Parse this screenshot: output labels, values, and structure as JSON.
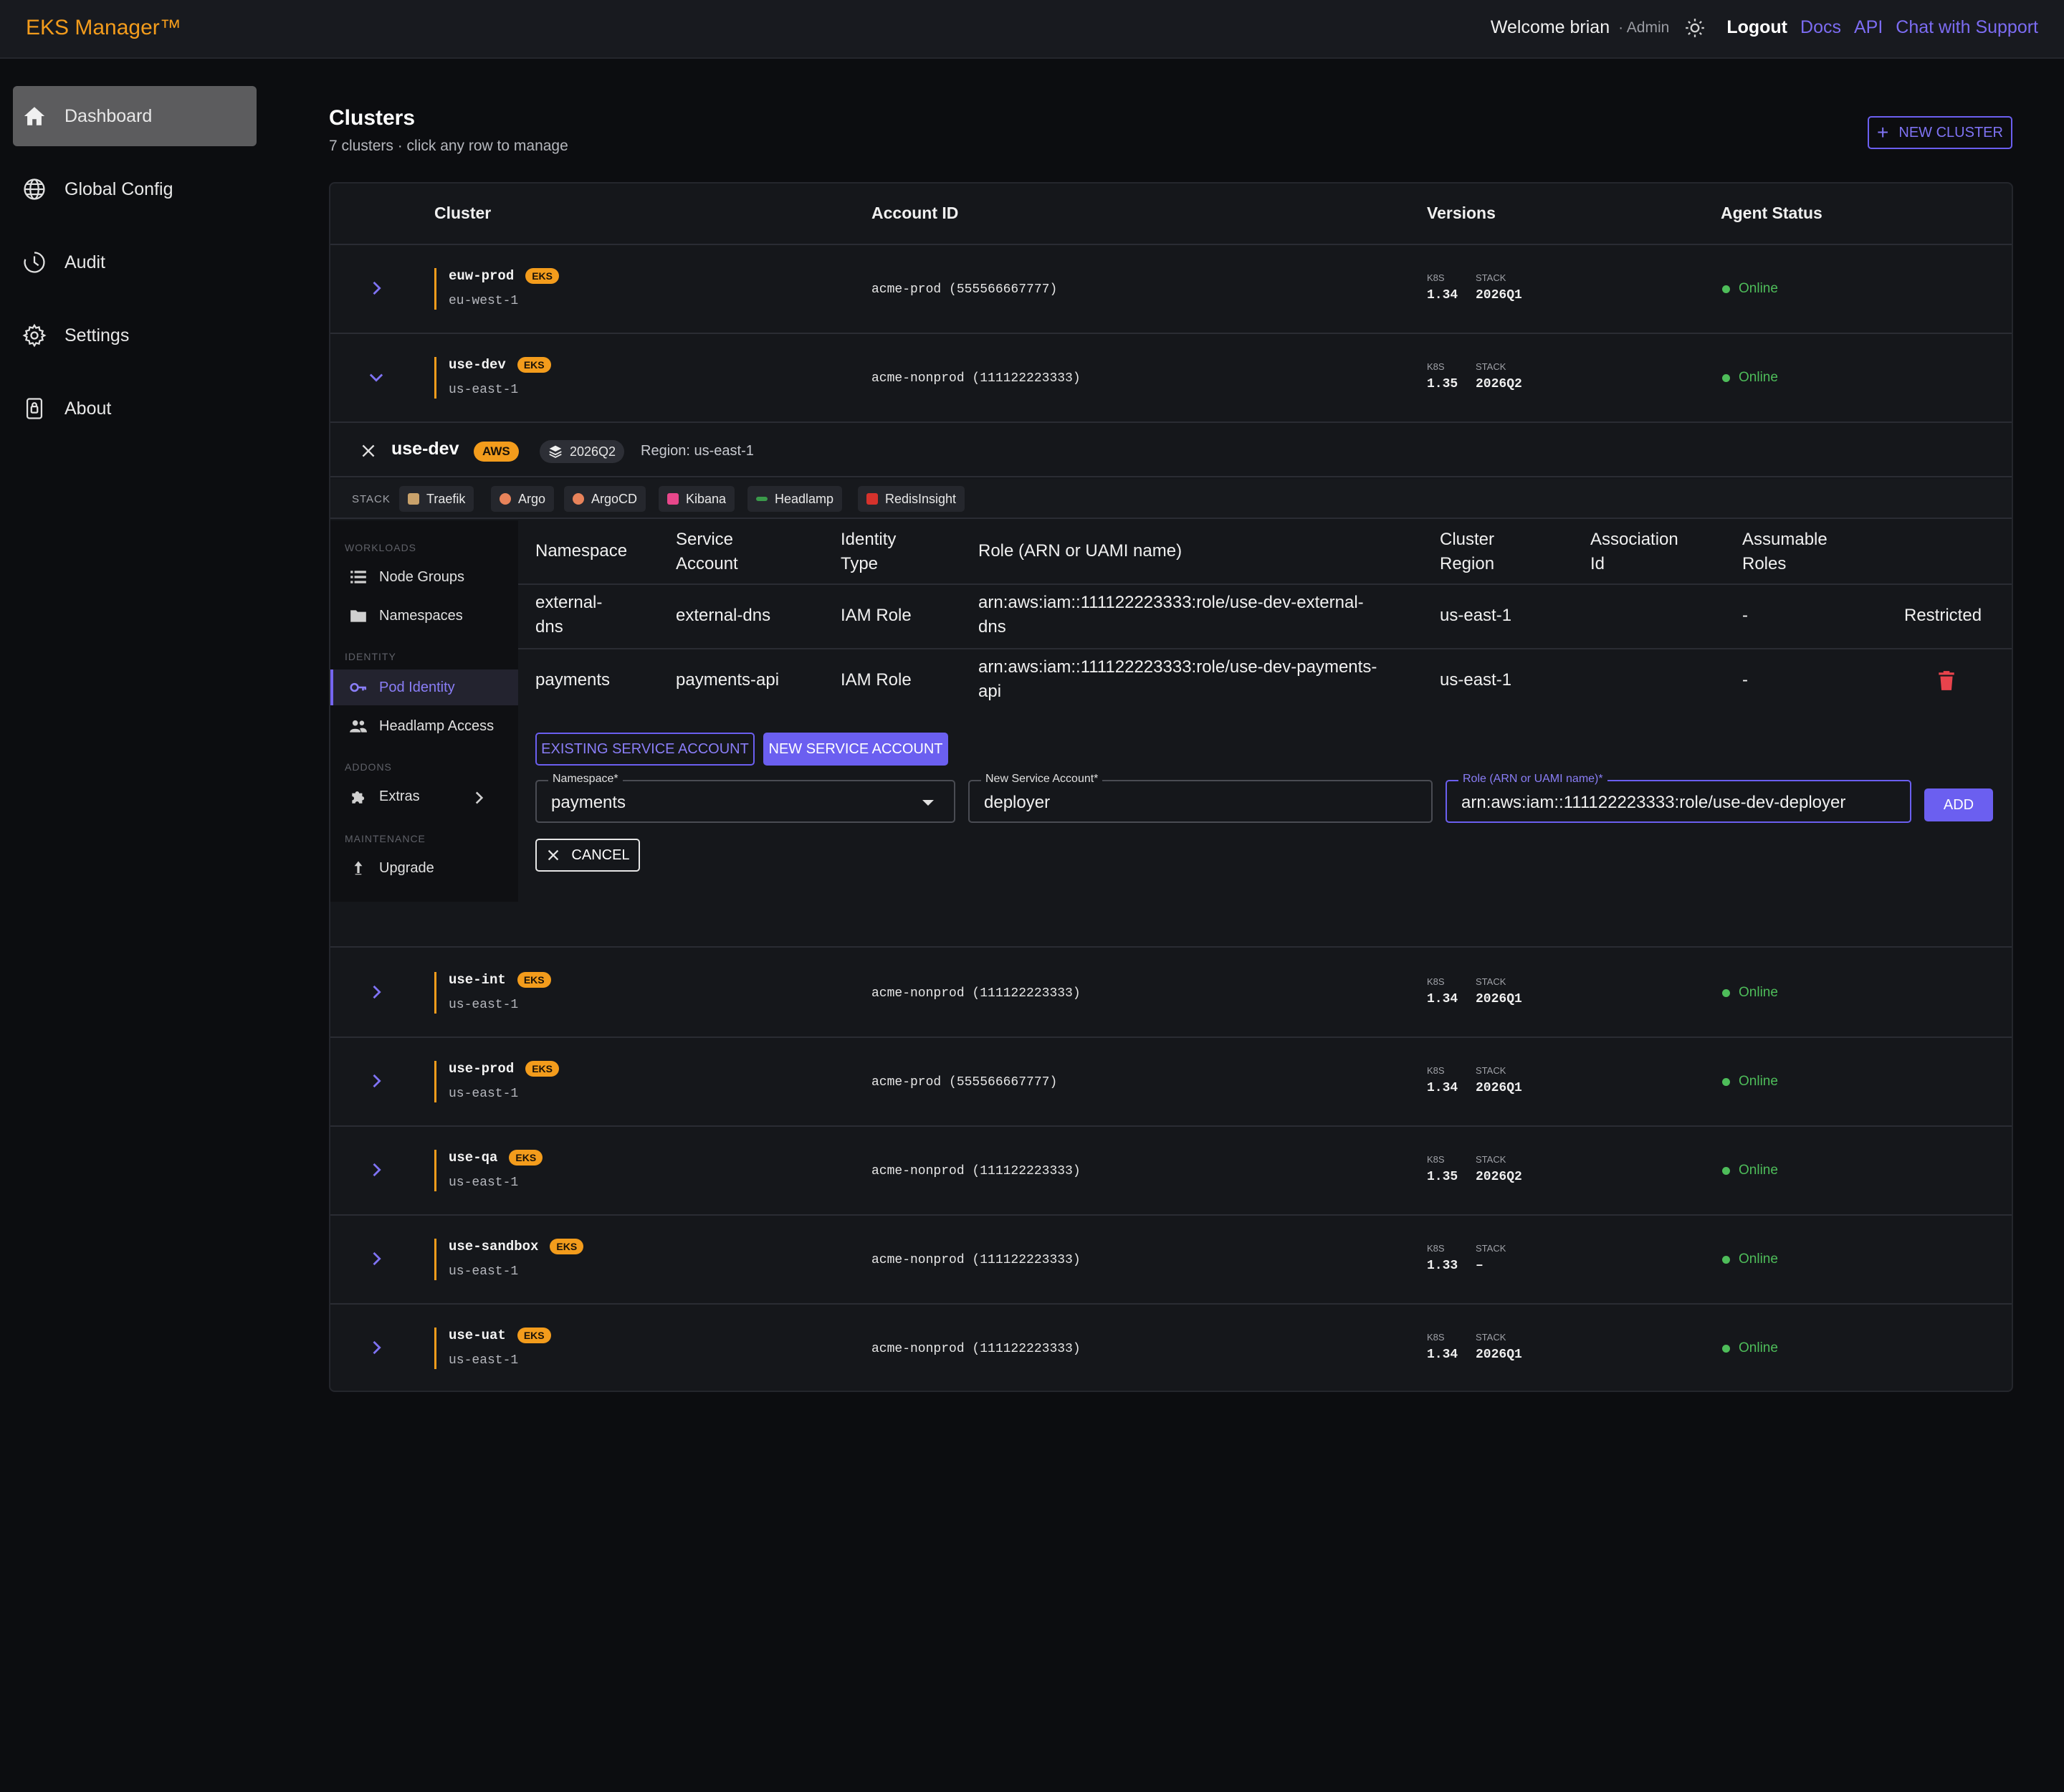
{
  "app": {
    "title": "EKS Manager™",
    "welcome": "Welcome brian",
    "role": "· Admin",
    "logout": "Logout",
    "links": [
      "Docs",
      "API",
      "Chat with Support"
    ]
  },
  "sidebar": {
    "items": [
      {
        "label": "Dashboard",
        "icon": "home-icon"
      },
      {
        "label": "Global Config",
        "icon": "globe-icon"
      },
      {
        "label": "Audit",
        "icon": "clock-icon"
      },
      {
        "label": "Settings",
        "icon": "gear-icon"
      },
      {
        "label": "About",
        "icon": "lock-icon"
      }
    ]
  },
  "main": {
    "title": "Clusters",
    "subtitle": "7 clusters · click any row to manage",
    "new_cluster": "NEW CLUSTER",
    "columns": [
      "Cluster",
      "Account ID",
      "Versions",
      "Agent Status"
    ],
    "k8s_label": "K8S",
    "stack_label": "STACK",
    "clusters": [
      {
        "name": "euw-prod",
        "badge": "EKS",
        "region": "eu-west-1",
        "account": "acme-prod (555566667777)",
        "k8s": "1.34",
        "stack": "2026Q1",
        "status": "Online"
      },
      {
        "name": "use-dev",
        "badge": "EKS",
        "region": "us-east-1",
        "account": "acme-nonprod (111122223333)",
        "k8s": "1.35",
        "stack": "2026Q2",
        "status": "Online"
      },
      {
        "name": "use-int",
        "badge": "EKS",
        "region": "us-east-1",
        "account": "acme-nonprod (111122223333)",
        "k8s": "1.34",
        "stack": "2026Q1",
        "status": "Online"
      },
      {
        "name": "use-prod",
        "badge": "EKS",
        "region": "us-east-1",
        "account": "acme-prod (555566667777)",
        "k8s": "1.34",
        "stack": "2026Q1",
        "status": "Online"
      },
      {
        "name": "use-qa",
        "badge": "EKS",
        "region": "us-east-1",
        "account": "acme-nonprod (111122223333)",
        "k8s": "1.35",
        "stack": "2026Q2",
        "status": "Online"
      },
      {
        "name": "use-sandbox",
        "badge": "EKS",
        "region": "us-east-1",
        "account": "acme-nonprod (111122223333)",
        "k8s": "1.33",
        "stack": "–",
        "status": "Online"
      },
      {
        "name": "use-uat",
        "badge": "EKS",
        "region": "us-east-1",
        "account": "acme-nonprod (111122223333)",
        "k8s": "1.34",
        "stack": "2026Q1",
        "status": "Online"
      }
    ]
  },
  "detail": {
    "name": "use-dev",
    "provider": "AWS",
    "version": "2026Q2",
    "region": "Region: us-east-1",
    "stack_label": "STACK",
    "stack": [
      {
        "label": "Traefik",
        "color": "#c9a26b"
      },
      {
        "label": "Argo",
        "color": "#e8835a"
      },
      {
        "label": "ArgoCD",
        "color": "#e8835a"
      },
      {
        "label": "Kibana",
        "color": "#e8478b"
      },
      {
        "label": "Headlamp",
        "color": "#3a9a4a"
      },
      {
        "label": "RedisInsight",
        "color": "#d6322c"
      }
    ],
    "subnav": {
      "sections": [
        "WORKLOADS",
        "IDENTITY",
        "ADDONS",
        "MAINTENANCE"
      ],
      "items": [
        "Node Groups",
        "Namespaces",
        "Pod Identity",
        "Headlamp Access",
        "Extras",
        "Upgrade"
      ]
    },
    "columns": [
      "Namespace",
      "Service\nAccount",
      "Identity\nType",
      "Role (ARN or UAMI name)",
      "Cluster\nRegion",
      "Association\nId",
      "Assumable\nRoles"
    ],
    "rows": [
      {
        "namespace": "external-\ndns",
        "service_account": "external-dns",
        "identity_type": "IAM Role",
        "role": "arn:aws:iam::111122223333:role/use-dev-external-\ndns",
        "region": "us-east-1",
        "association": "",
        "assumable": "-",
        "action": "Restricted"
      },
      {
        "namespace": "payments",
        "service_account": "payments-api",
        "identity_type": "IAM Role",
        "role": "arn:aws:iam::111122223333:role/use-dev-payments-\napi",
        "region": "us-east-1",
        "association": "",
        "assumable": "-",
        "action": ""
      }
    ],
    "existing_sa": "EXISTING SERVICE ACCOUNT",
    "new_sa": "NEW SERVICE ACCOUNT",
    "form": {
      "namespace_label": "Namespace*",
      "namespace_value": "payments",
      "sa_label": "New Service Account*",
      "sa_value": "deployer",
      "role_label": "Role (ARN or UAMI name)*",
      "role_value": "arn:aws:iam::111122223333:role/use-dev-deployer",
      "add": "ADD",
      "cancel": "CANCEL"
    }
  }
}
